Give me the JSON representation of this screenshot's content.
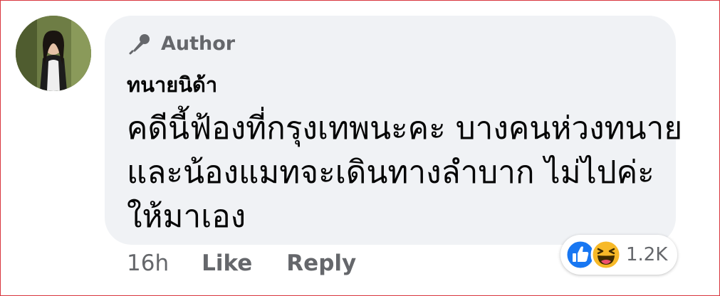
{
  "comment": {
    "badge_label": "Author",
    "author_name": "ทนายนิด้า",
    "text_lines": [
      "คดีนี้ฟ้องที่กรุงเทพนะคะ บางคนห่วงทนาย",
      "และน้องแมทจะเดินทางลำบาก ไม่ไปค่ะ",
      "ให้มาเอง"
    ],
    "timestamp": "16h",
    "like_label": "Like",
    "reply_label": "Reply",
    "reaction_count": "1.2K",
    "reaction_icons": [
      "like-icon",
      "haha-icon"
    ]
  },
  "colors": {
    "bubble": "#f0f2f5",
    "like_blue": "#1877f2",
    "haha_yellow": "#f7b928",
    "muted_text": "#65676b",
    "frame_border": "#d9363e"
  }
}
